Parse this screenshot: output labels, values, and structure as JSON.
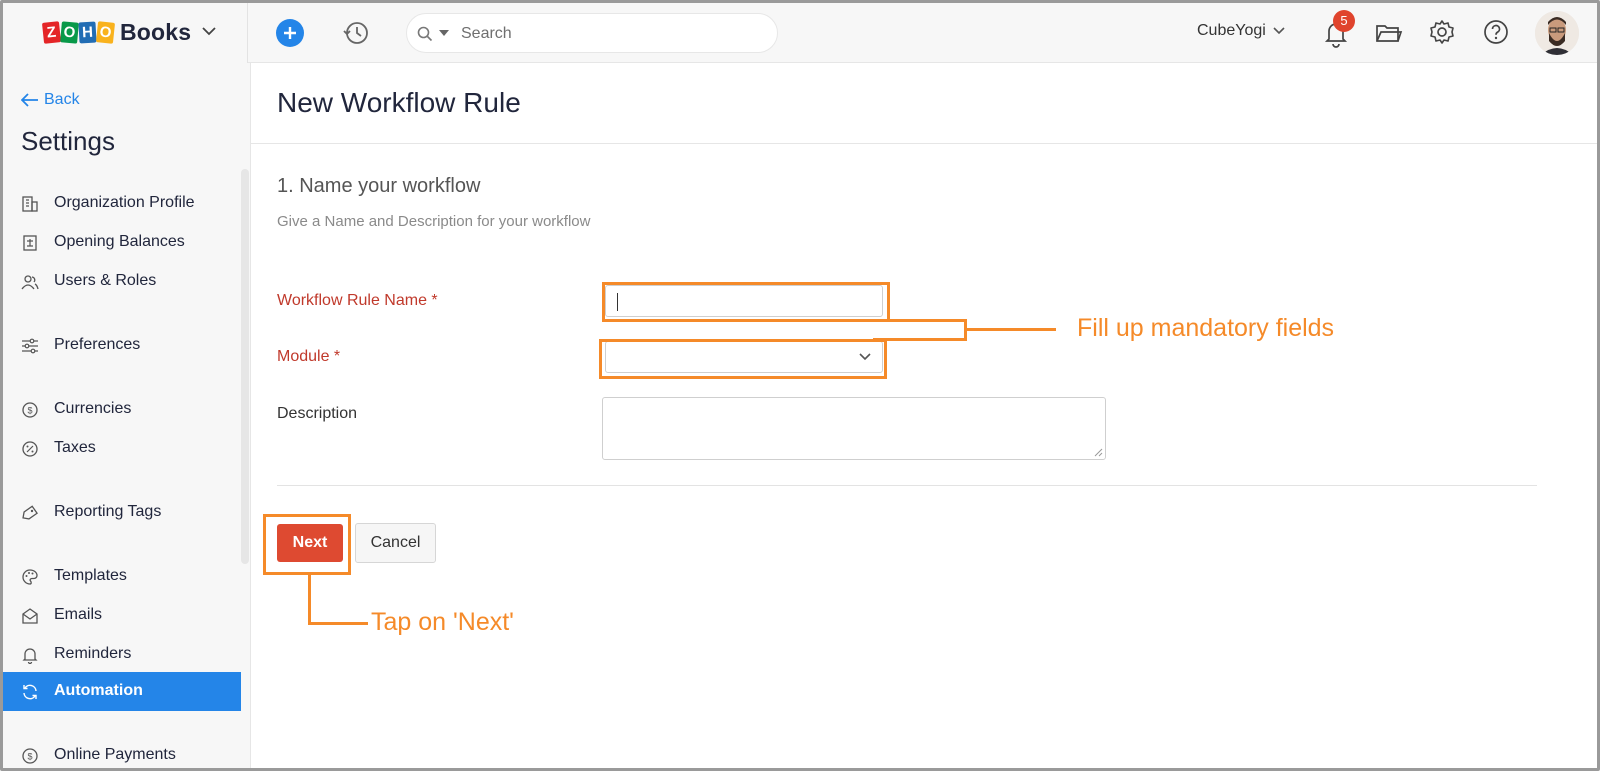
{
  "topbar": {
    "logo_letters": [
      "Z",
      "O",
      "H",
      "O"
    ],
    "product_name": "Books",
    "search_placeholder": "Search",
    "org_name": "CubeYogi",
    "notification_count": "5"
  },
  "sidebar": {
    "back_label": "Back",
    "title": "Settings",
    "items": [
      {
        "label": "Organization Profile",
        "icon": "building-icon"
      },
      {
        "label": "Opening Balances",
        "icon": "ledger-icon"
      },
      {
        "label": "Users & Roles",
        "icon": "users-icon"
      },
      {
        "label": "Preferences",
        "icon": "sliders-icon"
      },
      {
        "label": "Currencies",
        "icon": "currency-icon"
      },
      {
        "label": "Taxes",
        "icon": "percent-icon"
      },
      {
        "label": "Reporting Tags",
        "icon": "tag-icon"
      },
      {
        "label": "Templates",
        "icon": "palette-icon"
      },
      {
        "label": "Emails",
        "icon": "mail-icon"
      },
      {
        "label": "Reminders",
        "icon": "bell-icon"
      },
      {
        "label": "Automation",
        "icon": "sync-icon",
        "active": true
      },
      {
        "label": "Online Payments",
        "icon": "payment-icon"
      }
    ]
  },
  "main": {
    "page_title": "New Workflow Rule",
    "step_title": "1. Name your workflow",
    "step_subtitle": "Give a Name and Description for your workflow",
    "fields": {
      "name_label": "Workflow Rule Name *",
      "name_value": "",
      "module_label": "Module *",
      "module_value": "",
      "description_label": "Description",
      "description_value": ""
    },
    "buttons": {
      "next_label": "Next",
      "cancel_label": "Cancel"
    }
  },
  "annotations": {
    "fields_callout": "Fill up mandatory fields",
    "next_callout": "Tap on 'Next'",
    "color": "#f58a29"
  },
  "colors": {
    "accent_blue": "#2485e8",
    "primary_red": "#de4a31",
    "required_label": "#c0392b"
  }
}
